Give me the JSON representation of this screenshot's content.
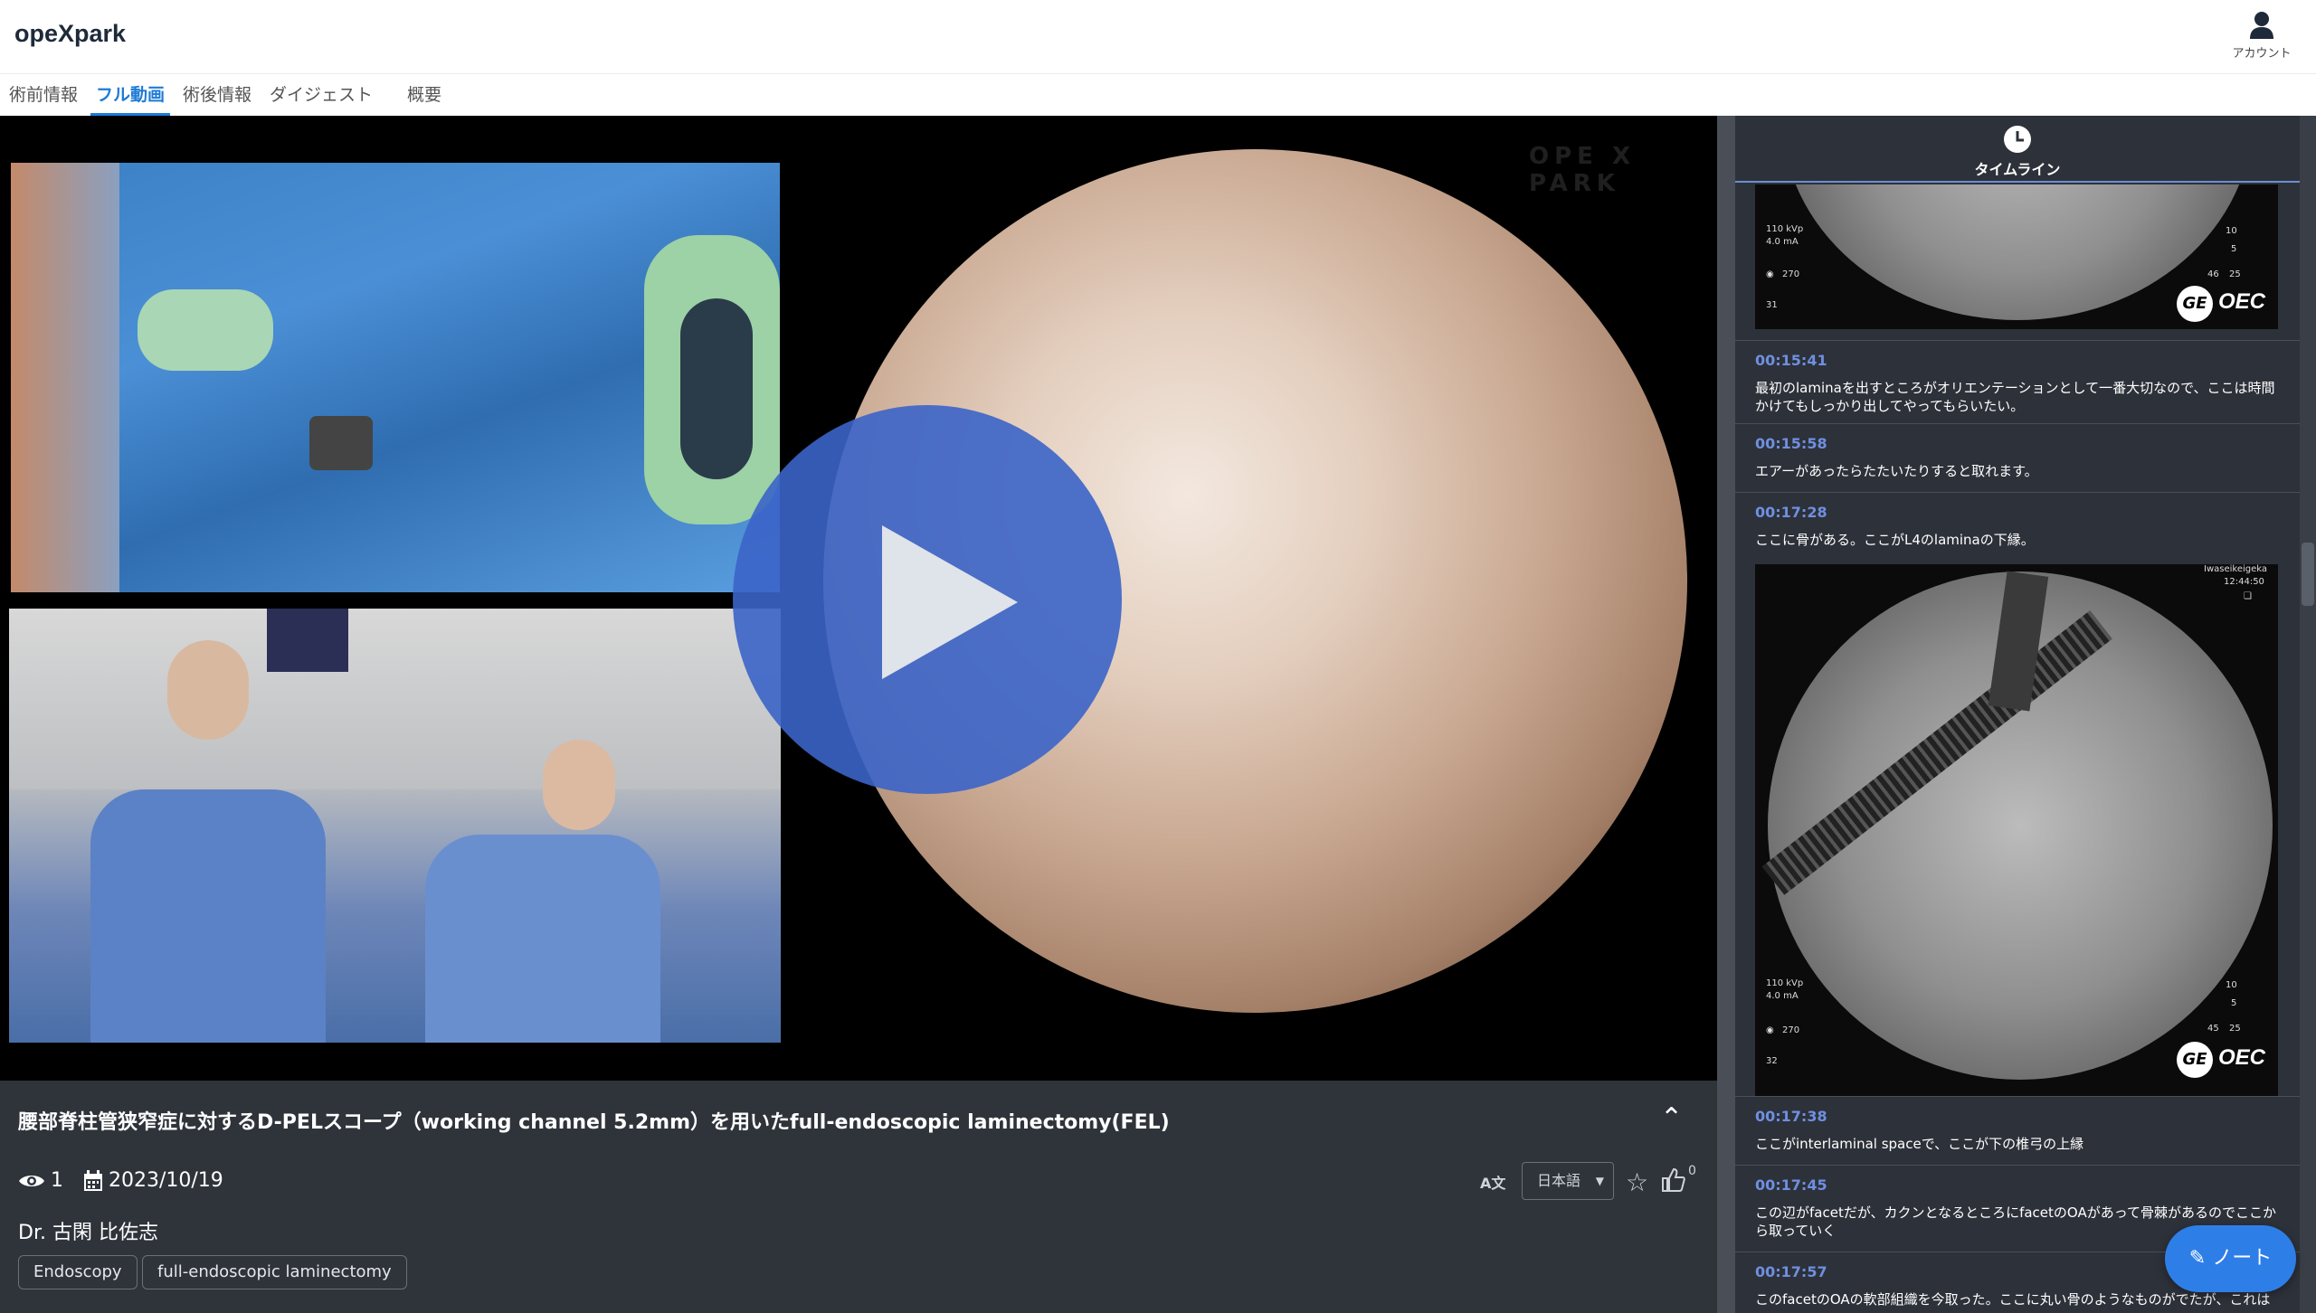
{
  "app": {
    "logo": "opeXpark"
  },
  "account": {
    "label": "アカウント"
  },
  "tabs": [
    {
      "label": "術前情報"
    },
    {
      "label": "フル動画"
    },
    {
      "label": "術後情報"
    },
    {
      "label": "ダイジェスト"
    },
    {
      "label": "概要"
    }
  ],
  "video": {
    "title": "腰部脊柱管狭窄症に対するD-PELスコープ（working channel 5.2mm）を用いたfull-endoscopic laminectomy(FEL)",
    "views": "1",
    "date": "2023/10/19",
    "doctor": "Dr. 古閑 比佐志",
    "tags": [
      "Endoscopy",
      "full-endoscopic laminectomy"
    ],
    "language": "日本語",
    "likes": "0"
  },
  "timeline": {
    "title": "タイムライン",
    "xray1": {
      "kvp": "110 kVp",
      "ma": "4.0 mA",
      "left_val": "270",
      "frame": "31",
      "right1": "10",
      "right2": "5",
      "right3": "46",
      "right4": "25",
      "brand": "OEC"
    },
    "xray2": {
      "site": "Iwaseikeigeka",
      "time": "12:44:50",
      "kvp": "110 kVp",
      "ma": "4.0 mA",
      "left_val": "270",
      "frame": "32",
      "right1": "10",
      "right2": "5",
      "right3": "45",
      "right4": "25",
      "brand": "OEC"
    },
    "entries": [
      {
        "time": "00:15:41",
        "text": "最初のlaminaを出すところがオリエンテーションとして一番大切なので、ここは時間かけてもしっかり出してやってもらいたい。"
      },
      {
        "time": "00:15:58",
        "text": "エアーがあったらたたいたりすると取れます。"
      },
      {
        "time": "00:17:28",
        "text": "ここに骨がある。ここがL4のlaminaの下縁。"
      },
      {
        "time": "00:17:38",
        "text": "ここがinterlaminal spaceで、ここが下の椎弓の上縁"
      },
      {
        "time": "00:17:45",
        "text": "この辺がfacetだが、カクンとなるところにfacetのOAがあって骨棘があるのでここから取っていく"
      },
      {
        "time": "00:17:57",
        "text": "このfacetのOAの軟部組織を今取った。ここに丸い骨のようなものがでたが、これは"
      }
    ]
  },
  "note_button": {
    "label": "ノート"
  },
  "colors": {
    "accent": "#1e7bd6",
    "timestamp": "#6f8fe0",
    "note": "#2e7ee8",
    "panel": "#2f343b"
  }
}
